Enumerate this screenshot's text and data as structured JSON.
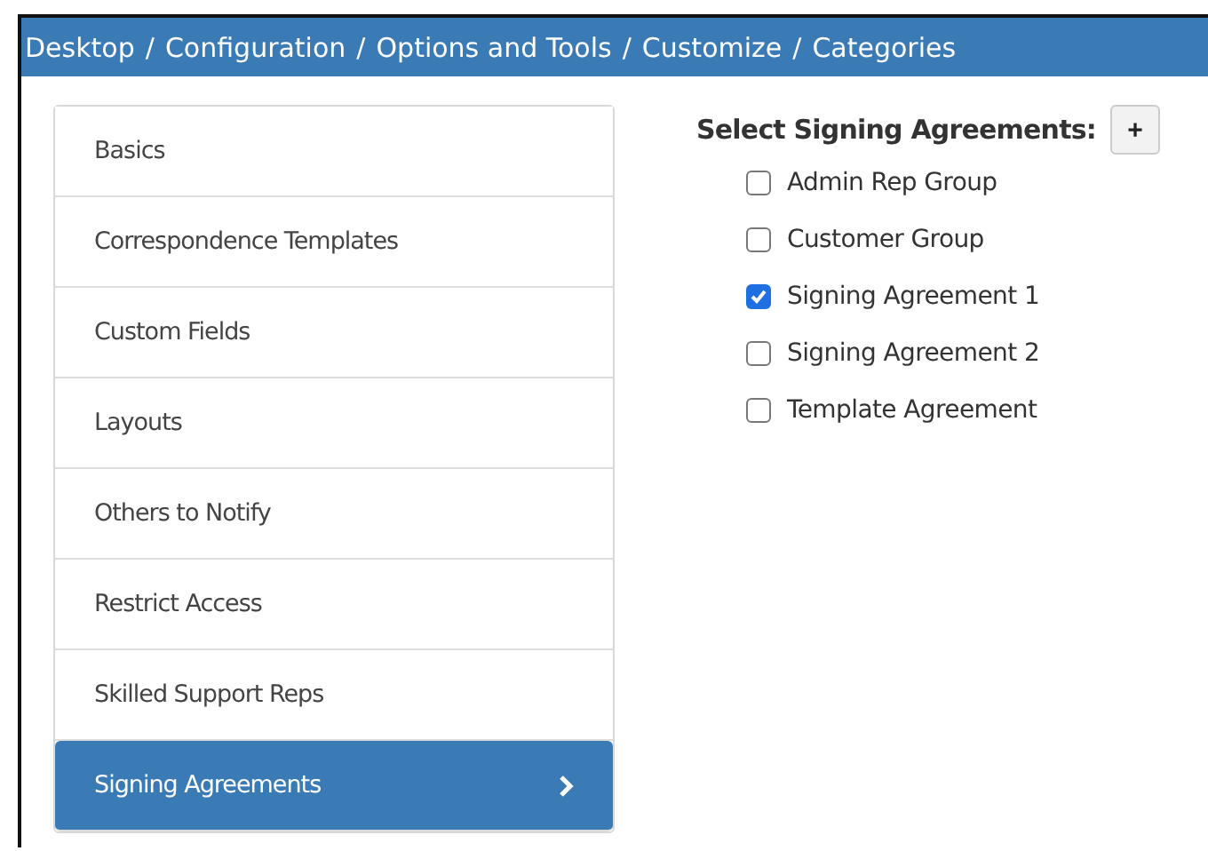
{
  "breadcrumb": {
    "separator": "/",
    "items": [
      "Desktop",
      "Configuration",
      "Options and Tools",
      "Customize",
      "Categories"
    ]
  },
  "sidebar": {
    "items": [
      {
        "label": "Basics",
        "selected": false
      },
      {
        "label": "Correspondence Templates",
        "selected": false
      },
      {
        "label": "Custom Fields",
        "selected": false
      },
      {
        "label": "Layouts",
        "selected": false
      },
      {
        "label": "Others to Notify",
        "selected": false
      },
      {
        "label": "Restrict Access",
        "selected": false
      },
      {
        "label": "Skilled Support Reps",
        "selected": false
      },
      {
        "label": "Signing Agreements",
        "selected": true
      }
    ]
  },
  "agreements": {
    "title": "Select Signing Agreements:",
    "add_button": "+",
    "options": [
      {
        "label": "Admin Rep Group",
        "checked": false
      },
      {
        "label": "Customer Group",
        "checked": false
      },
      {
        "label": "Signing Agreement 1",
        "checked": true
      },
      {
        "label": "Signing Agreement 2",
        "checked": false
      },
      {
        "label": "Template Agreement",
        "checked": false
      }
    ]
  }
}
